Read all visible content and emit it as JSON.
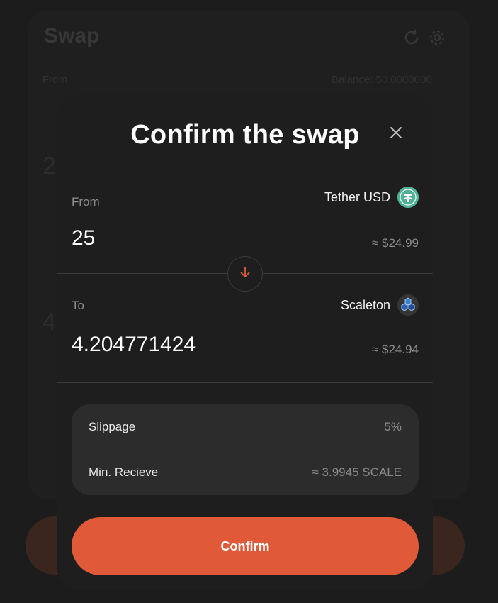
{
  "background": {
    "title": "Swap",
    "from_label": "From",
    "balance": "Balance: 50.0000000",
    "digit_top": "2",
    "digit_bottom": "4"
  },
  "modal": {
    "title": "Confirm the swap",
    "from": {
      "label": "From",
      "token_name": "Tether USD",
      "token_icon": "tether-icon",
      "amount": "25",
      "usd_value": "≈ $24.99"
    },
    "to": {
      "label": "To",
      "token_name": "Scaleton",
      "token_icon": "scaleton-icon",
      "amount": "4.204771424",
      "usd_value": "≈ $24.94"
    },
    "details": {
      "slippage_label": "Slippage",
      "slippage_value": "5%",
      "min_receive_label": "Min. Recieve",
      "min_receive_value": "≈ 3.9945 SCALE"
    },
    "confirm_label": "Confirm"
  },
  "colors": {
    "accent": "#e05a3a",
    "modal_bg": "#1e1e1e",
    "tether": "#50af95"
  }
}
